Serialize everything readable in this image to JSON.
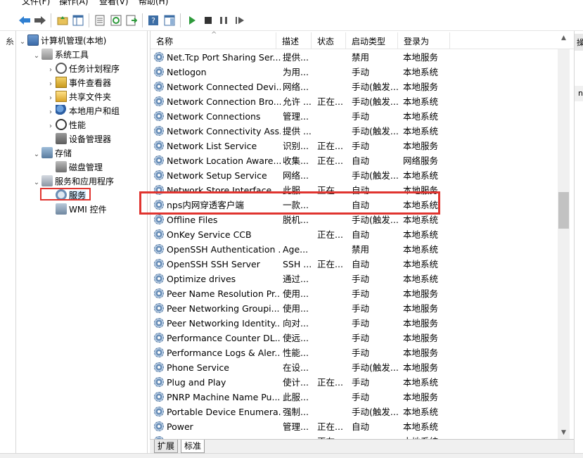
{
  "menu": [
    "文件(F)",
    "操作(A)",
    "查看(V)",
    "帮助(H)"
  ],
  "left_strip_text": "糸",
  "tree": [
    {
      "label": "计算机管理(本地)",
      "indent": 0,
      "expander": "⌄",
      "icon": "computer-icon"
    },
    {
      "label": "系统工具",
      "indent": 1,
      "expander": "⌄",
      "icon": "tools-icon"
    },
    {
      "label": "任务计划程序",
      "indent": 2,
      "expander": "›",
      "icon": "clock-icon"
    },
    {
      "label": "事件查看器",
      "indent": 2,
      "expander": "›",
      "icon": "event-viewer-icon"
    },
    {
      "label": "共享文件夹",
      "indent": 2,
      "expander": "›",
      "icon": "shared-folder-icon"
    },
    {
      "label": "本地用户和组",
      "indent": 2,
      "expander": "›",
      "icon": "users-icon"
    },
    {
      "label": "性能",
      "indent": 2,
      "expander": "›",
      "icon": "performance-icon"
    },
    {
      "label": "设备管理器",
      "indent": 2,
      "expander": "",
      "icon": "device-manager-icon"
    },
    {
      "label": "存储",
      "indent": 1,
      "expander": "⌄",
      "icon": "storage-icon"
    },
    {
      "label": "磁盘管理",
      "indent": 2,
      "expander": "",
      "icon": "disk-icon"
    },
    {
      "label": "服务和应用程序",
      "indent": 1,
      "expander": "⌄",
      "icon": "services-apps-icon"
    },
    {
      "label": "服务",
      "indent": 2,
      "expander": "",
      "icon": "gear-icon",
      "selected": true
    },
    {
      "label": "WMI 控件",
      "indent": 2,
      "expander": "",
      "icon": "wmi-icon"
    }
  ],
  "columns": [
    "名称",
    "描述",
    "状态",
    "启动类型",
    "登录为"
  ],
  "services": [
    [
      "Net.Tcp Port Sharing Ser...",
      "提供...",
      "",
      "禁用",
      "本地服务"
    ],
    [
      "Netlogon",
      "为用...",
      "",
      "手动",
      "本地系统"
    ],
    [
      "Network Connected Devi...",
      "网络...",
      "",
      "手动(触发...",
      "本地服务"
    ],
    [
      "Network Connection Bro...",
      "允许 ...",
      "正在...",
      "手动(触发...",
      "本地系统"
    ],
    [
      "Network Connections",
      "管理...",
      "",
      "手动",
      "本地系统"
    ],
    [
      "Network Connectivity Ass...",
      "提供 ...",
      "",
      "手动(触发...",
      "本地系统"
    ],
    [
      "Network List Service",
      "识别...",
      "正在...",
      "手动",
      "本地服务"
    ],
    [
      "Network Location Aware...",
      "收集...",
      "正在...",
      "自动",
      "网络服务"
    ],
    [
      "Network Setup Service",
      "网络...",
      "",
      "手动(触发...",
      "本地系统"
    ],
    [
      "Network Store Interface ...",
      "此服...",
      "正在...",
      "自动",
      "本地服务"
    ],
    [
      "nps内网穿透客户端",
      "一款...",
      "",
      "自动",
      "本地系统"
    ],
    [
      "Offline Files",
      "脱机...",
      "",
      "手动(触发...",
      "本地系统"
    ],
    [
      "OnKey Service CCB",
      "",
      "正在...",
      "自动",
      "本地系统"
    ],
    [
      "OpenSSH Authentication ...",
      "Age...",
      "",
      "禁用",
      "本地系统"
    ],
    [
      "OpenSSH SSH Server",
      "SSH ...",
      "正在...",
      "自动",
      "本地系统"
    ],
    [
      "Optimize drives",
      "通过...",
      "",
      "手动",
      "本地系统"
    ],
    [
      "Peer Name Resolution Pr...",
      "使用...",
      "",
      "手动",
      "本地服务"
    ],
    [
      "Peer Networking Groupi...",
      "使用...",
      "",
      "手动",
      "本地服务"
    ],
    [
      "Peer Networking Identity...",
      "向对...",
      "",
      "手动",
      "本地服务"
    ],
    [
      "Performance Counter DL...",
      "使远...",
      "",
      "手动",
      "本地服务"
    ],
    [
      "Performance Logs & Aler...",
      "性能...",
      "",
      "手动",
      "本地服务"
    ],
    [
      "Phone Service",
      "在设...",
      "",
      "手动(触发...",
      "本地服务"
    ],
    [
      "Plug and Play",
      "使计...",
      "正在...",
      "手动",
      "本地系统"
    ],
    [
      "PNRP Machine Name Pu...",
      "此服...",
      "",
      "手动",
      "本地服务"
    ],
    [
      "Portable Device Enumera...",
      "强制...",
      "",
      "手动(触发...",
      "本地系统"
    ],
    [
      "Power",
      "管理...",
      "正在...",
      "自动",
      "本地系统"
    ],
    [
      "",
      "",
      "正在...",
      "",
      "本地系统"
    ]
  ],
  "tabs": [
    "扩展",
    "标准"
  ],
  "right_strip": [
    "操",
    "n"
  ]
}
